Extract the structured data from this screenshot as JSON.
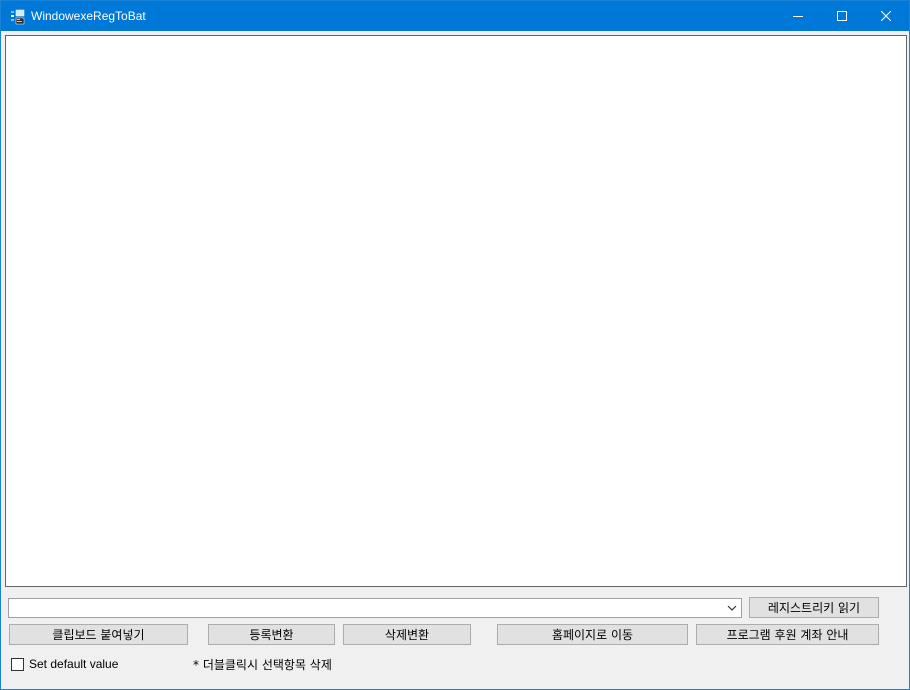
{
  "window": {
    "title": "WindowexeRegToBat",
    "controls": {
      "minimize": "minimize",
      "maximize": "maximize",
      "close": "close"
    },
    "accent_color": "#0078d7"
  },
  "combo": {
    "value": ""
  },
  "buttons": {
    "read_registry": "레지스트리키 읽기",
    "paste_clipboard": "클립보드 붙여넣기",
    "register_convert": "등록변환",
    "delete_convert": "삭제변환",
    "go_homepage": "홈페이지로 이동",
    "donation_info": "프로그램 후원 계좌 안내"
  },
  "options": {
    "set_default_label": "Set default value",
    "set_default_checked": false
  },
  "hint": "* 더블클릭시 선택항목 삭제"
}
